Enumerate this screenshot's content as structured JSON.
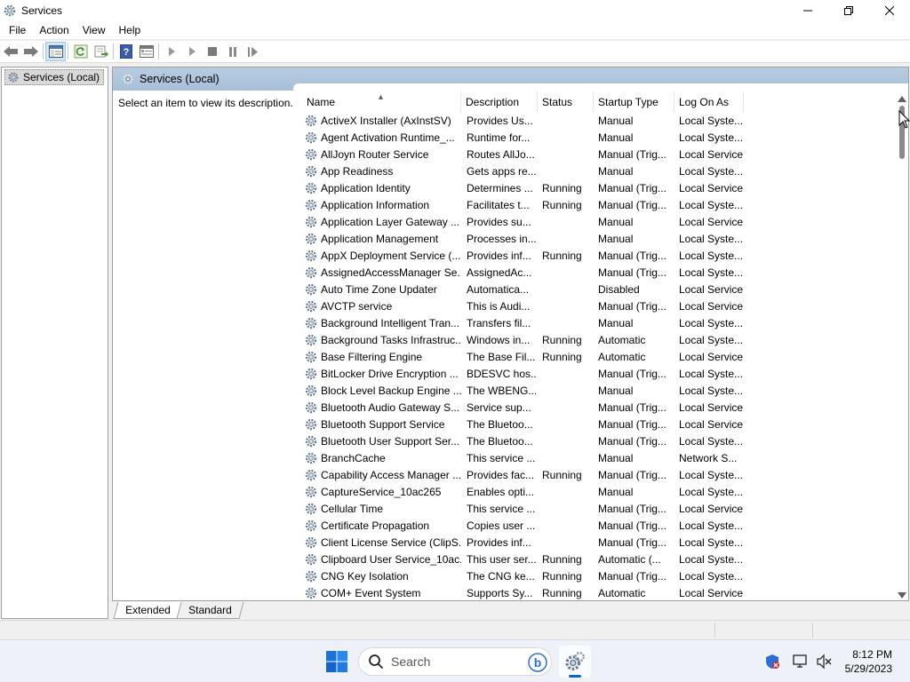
{
  "window": {
    "title": "Services"
  },
  "menu": [
    "File",
    "Action",
    "View",
    "Help"
  ],
  "tree": {
    "root_label": "Services (Local)"
  },
  "pane": {
    "header_title": "Services (Local)",
    "description_prompt": "Select an item to view its description."
  },
  "columns": {
    "name": "Name",
    "description": "Description",
    "status": "Status",
    "startup": "Startup Type",
    "logon": "Log On As"
  },
  "services": [
    {
      "name": "ActiveX Installer (AxInstSV)",
      "desc": "Provides Us...",
      "status": "",
      "startup": "Manual",
      "logon": "Local Syste..."
    },
    {
      "name": "Agent Activation Runtime_...",
      "desc": "Runtime for...",
      "status": "",
      "startup": "Manual",
      "logon": "Local Syste..."
    },
    {
      "name": "AllJoyn Router Service",
      "desc": "Routes AllJo...",
      "status": "",
      "startup": "Manual (Trig...",
      "logon": "Local Service"
    },
    {
      "name": "App Readiness",
      "desc": "Gets apps re...",
      "status": "",
      "startup": "Manual",
      "logon": "Local Syste..."
    },
    {
      "name": "Application Identity",
      "desc": "Determines ...",
      "status": "Running",
      "startup": "Manual (Trig...",
      "logon": "Local Service"
    },
    {
      "name": "Application Information",
      "desc": "Facilitates t...",
      "status": "Running",
      "startup": "Manual (Trig...",
      "logon": "Local Syste..."
    },
    {
      "name": "Application Layer Gateway ...",
      "desc": "Provides su...",
      "status": "",
      "startup": "Manual",
      "logon": "Local Service"
    },
    {
      "name": "Application Management",
      "desc": "Processes in...",
      "status": "",
      "startup": "Manual",
      "logon": "Local Syste..."
    },
    {
      "name": "AppX Deployment Service (...",
      "desc": "Provides inf...",
      "status": "Running",
      "startup": "Manual (Trig...",
      "logon": "Local Syste..."
    },
    {
      "name": "AssignedAccessManager Se...",
      "desc": "AssignedAc...",
      "status": "",
      "startup": "Manual (Trig...",
      "logon": "Local Syste..."
    },
    {
      "name": "Auto Time Zone Updater",
      "desc": "Automatica...",
      "status": "",
      "startup": "Disabled",
      "logon": "Local Service"
    },
    {
      "name": "AVCTP service",
      "desc": "This is Audi...",
      "status": "",
      "startup": "Manual (Trig...",
      "logon": "Local Service"
    },
    {
      "name": "Background Intelligent Tran...",
      "desc": "Transfers fil...",
      "status": "",
      "startup": "Manual",
      "logon": "Local Syste..."
    },
    {
      "name": "Background Tasks Infrastruc...",
      "desc": "Windows in...",
      "status": "Running",
      "startup": "Automatic",
      "logon": "Local Syste..."
    },
    {
      "name": "Base Filtering Engine",
      "desc": "The Base Fil...",
      "status": "Running",
      "startup": "Automatic",
      "logon": "Local Service"
    },
    {
      "name": "BitLocker Drive Encryption ...",
      "desc": "BDESVC hos...",
      "status": "",
      "startup": "Manual (Trig...",
      "logon": "Local Syste..."
    },
    {
      "name": "Block Level Backup Engine ...",
      "desc": "The WBENG...",
      "status": "",
      "startup": "Manual",
      "logon": "Local Syste..."
    },
    {
      "name": "Bluetooth Audio Gateway S...",
      "desc": "Service sup...",
      "status": "",
      "startup": "Manual (Trig...",
      "logon": "Local Service"
    },
    {
      "name": "Bluetooth Support Service",
      "desc": "The Bluetoo...",
      "status": "",
      "startup": "Manual (Trig...",
      "logon": "Local Service"
    },
    {
      "name": "Bluetooth User Support Ser...",
      "desc": "The Bluetoo...",
      "status": "",
      "startup": "Manual (Trig...",
      "logon": "Local Syste..."
    },
    {
      "name": "BranchCache",
      "desc": "This service ...",
      "status": "",
      "startup": "Manual",
      "logon": "Network S..."
    },
    {
      "name": "Capability Access Manager ...",
      "desc": "Provides fac...",
      "status": "Running",
      "startup": "Manual (Trig...",
      "logon": "Local Syste..."
    },
    {
      "name": "CaptureService_10ac265",
      "desc": "Enables opti...",
      "status": "",
      "startup": "Manual",
      "logon": "Local Syste..."
    },
    {
      "name": "Cellular Time",
      "desc": "This service ...",
      "status": "",
      "startup": "Manual (Trig...",
      "logon": "Local Service"
    },
    {
      "name": "Certificate Propagation",
      "desc": "Copies user ...",
      "status": "",
      "startup": "Manual (Trig...",
      "logon": "Local Syste..."
    },
    {
      "name": "Client License Service (ClipS...",
      "desc": "Provides inf...",
      "status": "",
      "startup": "Manual (Trig...",
      "logon": "Local Syste..."
    },
    {
      "name": "Clipboard User Service_10ac...",
      "desc": "This user ser...",
      "status": "Running",
      "startup": "Automatic (...",
      "logon": "Local Syste..."
    },
    {
      "name": "CNG Key Isolation",
      "desc": "The CNG ke...",
      "status": "Running",
      "startup": "Manual (Trig...",
      "logon": "Local Syste..."
    },
    {
      "name": "COM+ Event System",
      "desc": "Supports Sy...",
      "status": "Running",
      "startup": "Automatic",
      "logon": "Local Service"
    }
  ],
  "tabs": [
    "Extended",
    "Standard"
  ],
  "taskbar": {
    "search_placeholder": "Search",
    "time": "8:12 PM",
    "date": "5/29/2023"
  }
}
